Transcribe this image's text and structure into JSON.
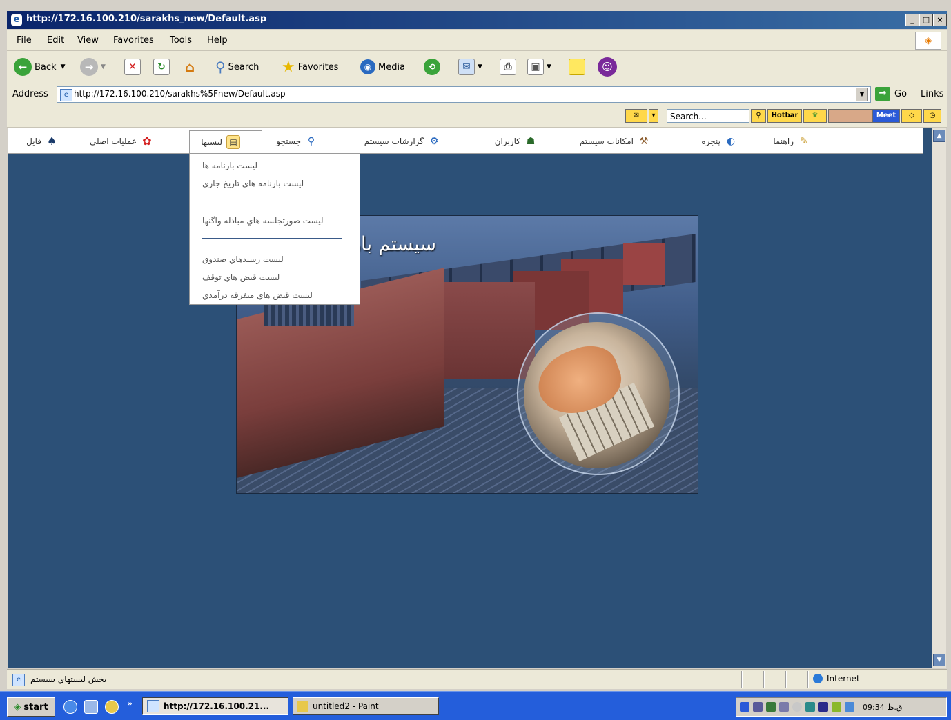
{
  "window": {
    "title": "http://172.16.100.210/sarakhs_new/Default.asp",
    "buttons": [
      "_",
      "□",
      "×"
    ]
  },
  "menubar": [
    "File",
    "Edit",
    "View",
    "Favorites",
    "Tools",
    "Help"
  ],
  "toolbar": {
    "back": "Back",
    "search": "Search",
    "favorites": "Favorites",
    "media": "Media"
  },
  "address": {
    "label": "Address",
    "url": "http://172.16.100.210/sarakhs%5Fnew/Default.asp",
    "go": "Go",
    "links": "Links"
  },
  "hotbar": {
    "search_placeholder": "Search...",
    "hotbar_label": "Hotbar",
    "meet_label": "Meet"
  },
  "nav": {
    "items": [
      {
        "label": "فايل",
        "icon": "spade-icon"
      },
      {
        "label": "عمليات اصلي",
        "icon": "gear-icon"
      },
      {
        "label": "ليستها",
        "icon": "list-icon"
      },
      {
        "label": "جستجو",
        "icon": "search-icon"
      },
      {
        "label": "گزارشات سيستم",
        "icon": "report-icon"
      },
      {
        "label": "کاربران",
        "icon": "users-icon"
      },
      {
        "label": "امکانات سيستم",
        "icon": "tools-icon"
      },
      {
        "label": "پنجره",
        "icon": "window-icon"
      },
      {
        "label": "راهنما",
        "icon": "help-icon"
      }
    ]
  },
  "dropdown": {
    "items": [
      "ليست بارنامه ها",
      "ليست بارنامه هاي تاريخ جاري",
      "ليست صورتجلسه هاي مبادله واگنها",
      "ليست رسيدهاي صندوق",
      "ليست قبض هاي توقف",
      "ليست قبض هاي متفرقه درآمدي"
    ]
  },
  "banner": {
    "title": "سيستم بارنامه"
  },
  "status": {
    "text": "بخش ليستهاي سيستم",
    "zone": "Internet"
  },
  "taskbar": {
    "start": "start",
    "chevron": "»",
    "tasks": [
      "http://172.16.100.21...",
      "untitled2 - Paint"
    ],
    "clock": "09:34 ق.ظ"
  },
  "colors": {
    "page_background": "#2c5077",
    "titlebar": "#0a246a",
    "taskbar": "#245edb"
  }
}
